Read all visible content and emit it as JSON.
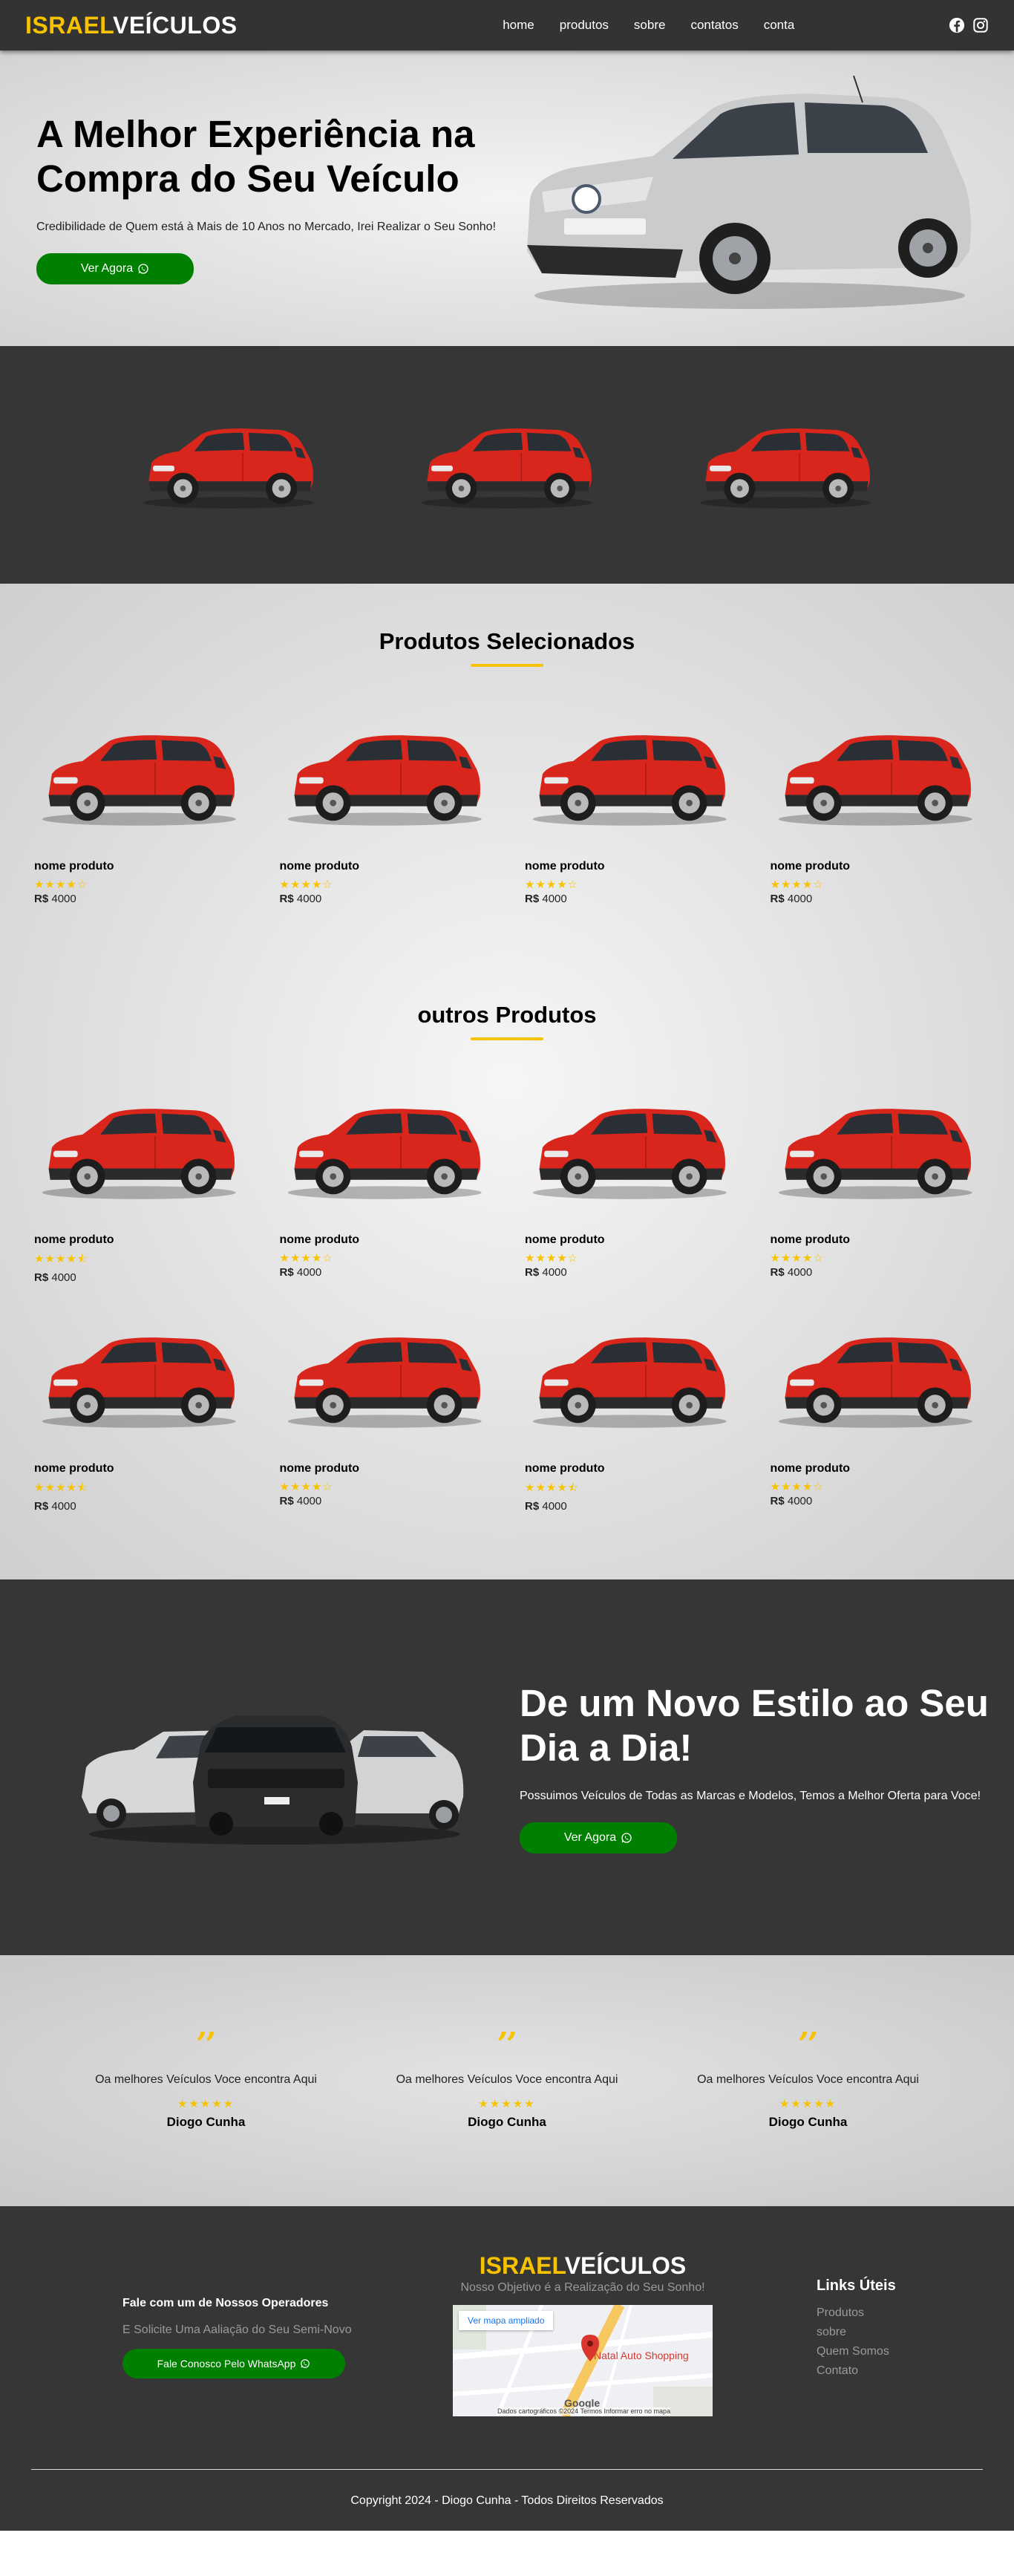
{
  "nav": {
    "logo_part1": "ISRAEL",
    "logo_part2": "VEÍCULOS",
    "links": [
      "home",
      "produtos",
      "sobre",
      "contatos",
      "conta"
    ],
    "social_icons": [
      "facebook-icon",
      "instagram-icon"
    ]
  },
  "hero": {
    "title": "A Melhor Experiência na Compra do Seu Veículo",
    "subtitle": "Credibilidade de Quem está à Mais de 10 Anos no Mercado, Irei Realizar o Seu Sonho!",
    "button_label": "Ver Agora"
  },
  "featured": {
    "title": "Produtos Selecionados",
    "products": [
      {
        "name": "nome produto",
        "rating": 4,
        "currency": "R$",
        "price": "4000"
      },
      {
        "name": "nome produto",
        "rating": 4,
        "currency": "R$",
        "price": "4000"
      },
      {
        "name": "nome produto",
        "rating": 4,
        "currency": "R$",
        "price": "4000"
      },
      {
        "name": "nome produto",
        "rating": 4,
        "currency": "R$",
        "price": "4000"
      }
    ]
  },
  "others": {
    "title": "outros Produtos",
    "products": [
      {
        "name": "nome produto",
        "rating": 4.5,
        "currency": "R$",
        "price": "4000"
      },
      {
        "name": "nome produto",
        "rating": 4,
        "currency": "R$",
        "price": "4000"
      },
      {
        "name": "nome produto",
        "rating": 4,
        "currency": "R$",
        "price": "4000"
      },
      {
        "name": "nome produto",
        "rating": 4,
        "currency": "R$",
        "price": "4000"
      },
      {
        "name": "nome produto",
        "rating": 4.5,
        "currency": "R$",
        "price": "4000"
      },
      {
        "name": "nome produto",
        "rating": 4,
        "currency": "R$",
        "price": "4000"
      },
      {
        "name": "nome produto",
        "rating": 4.5,
        "currency": "R$",
        "price": "4000"
      },
      {
        "name": "nome produto",
        "rating": 4,
        "currency": "R$",
        "price": "4000"
      }
    ]
  },
  "promo": {
    "title": "De um Novo Estilo ao Seu Dia a Dia!",
    "subtitle": "Possuimos Veículos de Todas as Marcas e Modelos, Temos a Melhor Oferta para Voce!",
    "button_label": "Ver Agora"
  },
  "testimonials": [
    {
      "text": "Oa melhores Veículos Voce encontra Aqui",
      "rating": 5,
      "name": "Diogo Cunha"
    },
    {
      "text": "Oa melhores Veículos Voce encontra Aqui",
      "rating": 5,
      "name": "Diogo Cunha"
    },
    {
      "text": "Oa melhores Veículos Voce encontra Aqui",
      "rating": 5,
      "name": "Diogo Cunha"
    }
  ],
  "footer": {
    "contact_title": "Fale com um de Nossos Operadores",
    "contact_sub": "E Solicite Uma Aaliação do Seu Semi-Novo",
    "whatsapp_button": "Fale Conosco Pelo WhatsApp",
    "logo_part1": "ISRAEL",
    "logo_part2": "VEÍCULOS",
    "tagline": "Nosso Objetivo é a Realização do Seu Sonho!",
    "map_button": "Ver mapa ampliado",
    "map_place": "Natal Auto Shopping",
    "map_attribution": "Dados cartográficos ©2024   Termos   Informar erro no mapa",
    "map_logo": "Google",
    "links_title": "Links Úteis",
    "links": [
      "Produtos",
      "sobre",
      "Quem Somos",
      "Contato"
    ],
    "copyright": "Copyright 2024 - Diogo Cunha - Todos Direitos Reservados"
  },
  "colors": {
    "accent_yellow": "#f7c300",
    "nav_dark": "#333333",
    "section_dark": "#363636",
    "button_green": "#008000",
    "car_red": "#d9261c"
  }
}
